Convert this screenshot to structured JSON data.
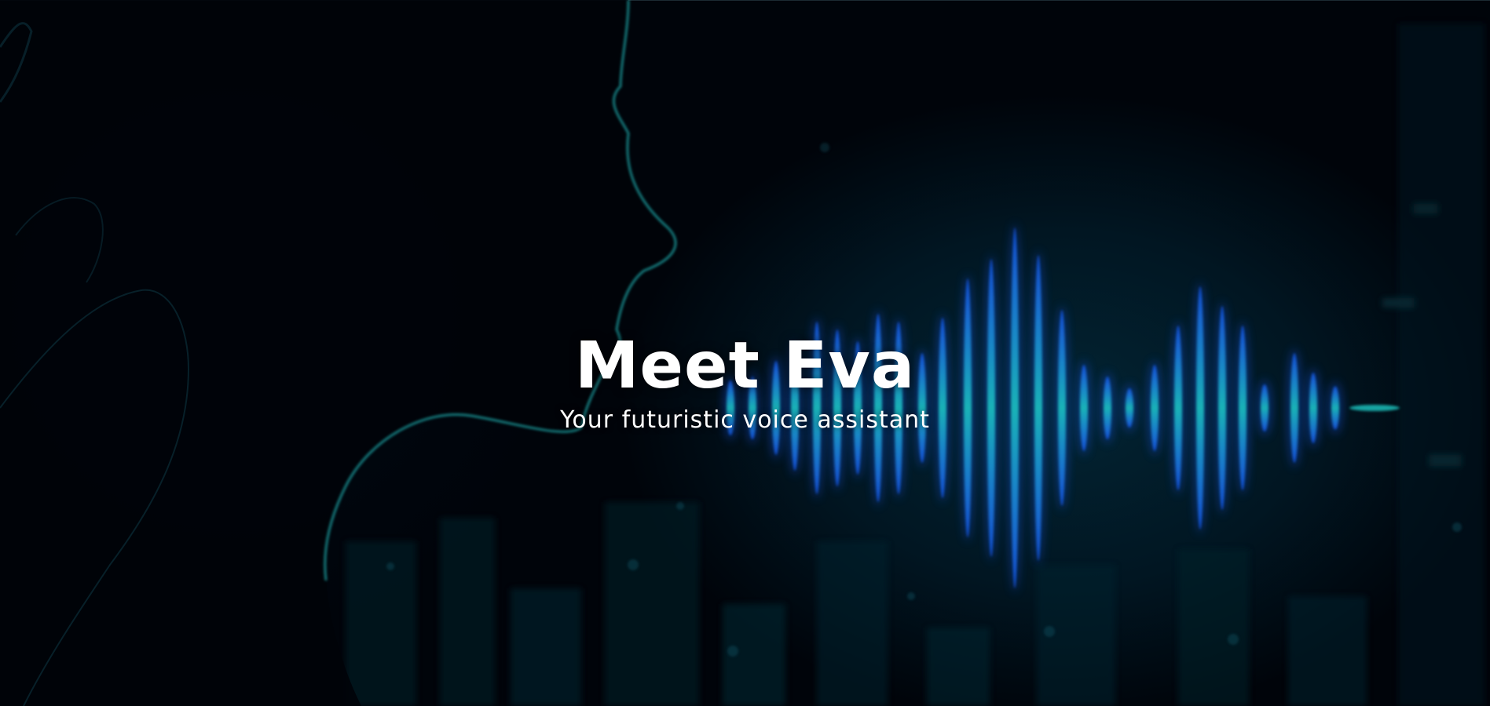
{
  "hero": {
    "title": "Meet Eva",
    "subtitle": "Your futuristic voice assistant"
  },
  "theme": {
    "background": "#00050d",
    "accent": "#19c3c8",
    "glow": "#1a6cff",
    "text": "#ffffff"
  },
  "background_image": {
    "icon": "woman-profile-soundwave-illustration"
  }
}
